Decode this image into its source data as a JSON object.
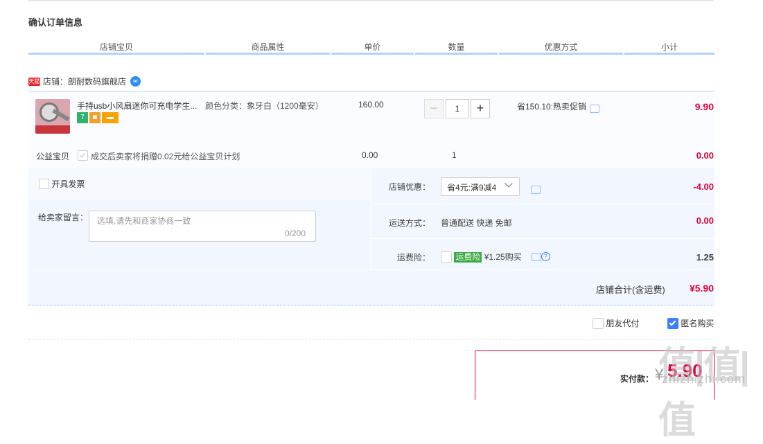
{
  "page": {
    "title": "确认订单信息"
  },
  "columns": [
    "店铺宝贝",
    "商品属性",
    "单价",
    "数量",
    "优惠方式",
    "小计"
  ],
  "shop": {
    "tmall_badge": "天猫",
    "name": "店铺：朗耐数码旗舰店"
  },
  "item": {
    "name": "手持usb小风扇迷你可充电学生...",
    "sku": "颜色分类：象牙白（1200毫安）",
    "price": "160.00",
    "qty": "1",
    "minus": "−",
    "plus": "+",
    "promo": "省150.10:热卖促销",
    "subtotal": "9.90",
    "badges": [
      "7",
      "",
      ""
    ]
  },
  "charity": {
    "label": "公益宝贝",
    "text": "成交后卖家将捐赠0.02元给公益宝贝计划",
    "price": "0.00",
    "qty": "1",
    "subtotal": "0.00"
  },
  "invoice": {
    "label": "开具发票"
  },
  "message": {
    "label": "给卖家留言：",
    "placeholder": "选填,请先和商家协商一致",
    "count": "0/200"
  },
  "shop_discount": {
    "label": "店铺优惠：",
    "value": "省4元:满9减4",
    "amount": "-4.00"
  },
  "shipping": {
    "label": "运送方式：",
    "value": "普通配送 快递 免邮",
    "amount": "0.00"
  },
  "insurance": {
    "label": "运费险：",
    "tag": "运费险",
    "text": "¥1.25购买",
    "amount": "1.25"
  },
  "shop_total": {
    "label": "店铺合计(含运费)",
    "value": "¥5.90"
  },
  "options": {
    "friend_pay": "朋友代付",
    "anonymous": "匿名购买"
  },
  "pay": {
    "label": "实付款：",
    "currency": "¥",
    "value": "5.90"
  },
  "watermark": {
    "main": "值|值|值",
    "sub": "zhizhizhi.com"
  }
}
